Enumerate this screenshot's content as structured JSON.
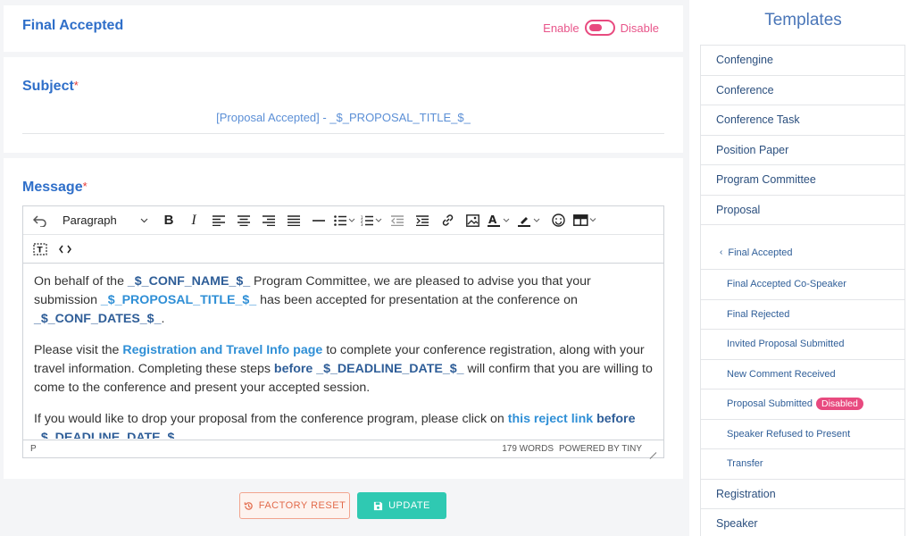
{
  "header": {
    "title": "Final Accepted",
    "toggle_on": "Enable",
    "toggle_off": "Disable"
  },
  "subject": {
    "label": "Subject",
    "required": "*",
    "value": "[Proposal Accepted] - _$_PROPOSAL_TITLE_$_"
  },
  "message": {
    "label": "Message",
    "required": "*",
    "toolbar": {
      "block_format": "Paragraph"
    },
    "p1": {
      "t1": "On behalf of the ",
      "conf_name": "_$_CONF_NAME_$_",
      "t2": " Program Committee, we are pleased to advise you that your submission ",
      "proposal_title": "_$_PROPOSAL_TITLE_$_",
      "t3": " has been accepted for presentation at the conference on ",
      "conf_dates": "_$_CONF_DATES_$_",
      "t4": "."
    },
    "p2": {
      "t1": "Please visit the ",
      "link": "Registration and Travel Info page",
      "t2": " to complete your conference registration, along with your travel information. Completing these steps ",
      "before": "before",
      "t3": " ",
      "deadline": "_$_DEADLINE_DATE_$_",
      "t4": " will confirm that you are willing to come to the conference and present your accepted session."
    },
    "p3": {
      "t1": "If you would like to drop your proposal from the conference program, please click on ",
      "link": "this reject link",
      "t2": " ",
      "before": "before",
      "t3": " ",
      "deadline": "_$_DEADLINE_DATE_$_",
      "t4": "."
    },
    "status": {
      "path": "P",
      "words": "179 WORDS",
      "powered": "POWERED BY TINY"
    }
  },
  "buttons": {
    "reset": "FACTORY RESET",
    "update": "UPDATE"
  },
  "colors": {
    "accent": "#2f6fc9",
    "toggle": "#e84a7f",
    "update": "#2fc9b2",
    "reset": "#e26a4a"
  },
  "sidebar": {
    "title": "Templates",
    "items": [
      {
        "label": "Confengine"
      },
      {
        "label": "Conference"
      },
      {
        "label": "Conference Task"
      },
      {
        "label": "Position Paper"
      },
      {
        "label": "Program Committee"
      },
      {
        "label": "Proposal"
      }
    ],
    "proposal_children": [
      {
        "label": "Final Accepted"
      },
      {
        "label": "Final Accepted Co-Speaker"
      },
      {
        "label": "Final Rejected"
      },
      {
        "label": "Invited Proposal Submitted"
      },
      {
        "label": "New Comment Received"
      },
      {
        "label": "Proposal Submitted",
        "badge": "Disabled"
      },
      {
        "label": "Speaker Refused to Present"
      },
      {
        "label": "Transfer"
      }
    ],
    "items_after": [
      {
        "label": "Registration"
      },
      {
        "label": "Speaker"
      }
    ]
  }
}
